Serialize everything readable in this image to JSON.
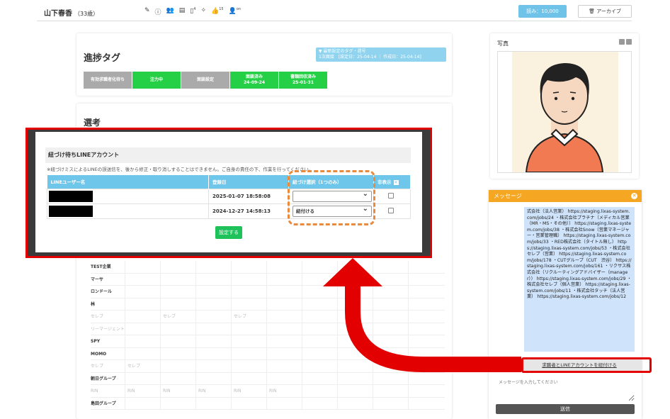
{
  "header": {
    "user_name": "山下春香",
    "user_age": "（33歳）",
    "icon_badge_1": "4",
    "icon_badge_2": "15",
    "icon_badge_3": "on",
    "count_button": "読み：10,000",
    "archive_button": "アーカイブ"
  },
  "progress_card": {
    "title": "進捗タグ",
    "info_line1": "▼ 最新設定のタグ・週号",
    "info_line2": "1次面接　[設定日：25-04-14 ｜ 作成日：25-04-14]",
    "tags": [
      {
        "label": "有効求職者化待ち",
        "sub": "",
        "color": "gray"
      },
      {
        "label": "注力中",
        "sub": "",
        "color": "green"
      },
      {
        "label": "面談設定",
        "sub": "",
        "color": "gray"
      },
      {
        "label": "面談済み",
        "sub": "24-09-24",
        "color": "green"
      },
      {
        "label": "書類回収済み",
        "sub": "25-01-31",
        "color": "green"
      }
    ]
  },
  "senko_card": {
    "title": "選考"
  },
  "background_rows": [
    {
      "name": "TEST企業",
      "cells": [
        "",
        "",
        "",
        "",
        "",
        "",
        "",
        "",
        ""
      ],
      "faint": false
    },
    {
      "name": "マーサ",
      "cells": [
        "",
        "",
        "",
        "",
        "",
        "",
        "",
        "",
        ""
      ],
      "faint": false
    },
    {
      "name": "ロンドール",
      "cells": [
        "",
        "",
        "",
        "",
        "",
        "",
        "",
        "",
        ""
      ],
      "faint": false
    },
    {
      "name": "林",
      "cells": [
        "",
        "",
        "",
        "",
        "",
        "",
        "",
        "",
        ""
      ],
      "faint": false
    },
    {
      "name": "セレブ",
      "cells": [
        "",
        "セレブ",
        "",
        "セレブ",
        "",
        "",
        "",
        "",
        ""
      ],
      "faint": true
    },
    {
      "name": "リーマージェント",
      "cells": [
        "",
        "",
        "",
        "",
        "",
        "",
        "",
        "",
        ""
      ],
      "faint": true
    },
    {
      "name": "SPY",
      "cells": [
        "",
        "",
        "",
        "",
        "",
        "",
        "",
        "",
        ""
      ],
      "faint": false
    },
    {
      "name": "MOMO",
      "cells": [
        "",
        "",
        "",
        "",
        "",
        "",
        "",
        "",
        ""
      ],
      "faint": false
    },
    {
      "name": "セレブ",
      "cells": [
        "セレブ",
        "",
        "",
        "",
        "",
        "",
        "",
        "",
        ""
      ],
      "faint": true
    },
    {
      "name": "朝日グループ",
      "cells": [
        "",
        "",
        "",
        "",
        "",
        "",
        "",
        "",
        ""
      ],
      "faint": false
    },
    {
      "name": "RIN",
      "cells": [
        "RIN",
        "RIN",
        "RIN",
        "RIN",
        "RIN",
        "",
        "",
        "",
        ""
      ],
      "faint": true
    },
    {
      "name": "島田グループ",
      "cells": [
        "",
        "",
        "",
        "",
        "",
        "",
        "",
        "",
        ""
      ],
      "faint": false
    }
  ],
  "photo_card": {
    "title": "写真"
  },
  "message_panel": {
    "title": "メッセージ",
    "bubble_text": "式会社（法人営業） https://staging.lixas-system.com/jobs/24 ・株式会社プラチナ（メディカル営業（MR・MS・その他）） https://staging.lixas-system.com/jobs/38 ・株式会社Snow（営業マネージャー・営業管理職） https://staging.lixas-system.com/jobs/33 ・RED株式会社（タイトル無し） https://staging.lixas-system.com/jobs/53 ・株式会社セレブ（営業） https://staging.lixas-system.com/jobs/178 ・CUTグループ（CUT　渋谷） https://staging.lixas-system.com/jobs/161 ・リクサス株式会社（リクルーティングアドバイザー（manager）） https://staging.lixas-system.com/jobs/29 ・株式会社セレブ（個人営業） https://staging.lixas-system.com/jobs/11 ・株式会社タッチ（法人営業） https://staging.lixas-system.com/jobs/12",
    "link_label": "求職者とLINEアカウントを紐付ける",
    "input_placeholder": "メッセージを入力してください",
    "send_label": "送信"
  },
  "modal": {
    "title": "紐づけ待ちLINEアカウント",
    "note": "※紐づけミスによるLINEの誤送信を、後から修正・取り消しすることはできません。ご自身の責任の下、作業を行ってください。",
    "columns": [
      "LINEユーザー名",
      "登録日",
      "紐づけ選択（1つのみ）",
      "非表示"
    ],
    "rows": [
      {
        "user": "",
        "date": "2025-01-07 18:58:08",
        "select": ""
      },
      {
        "user": "",
        "date": "2024-12-27 14:58:13",
        "select": "紐付ける"
      }
    ],
    "submit_label": "設定する"
  },
  "colors": {
    "accent_blue": "#6ec6ea",
    "tag_green": "#25d046",
    "tag_gray": "#aaaaaa",
    "message_orange": "#f5a623",
    "callout_red": "#e30000",
    "dashed_orange": "#ea8a3c"
  }
}
